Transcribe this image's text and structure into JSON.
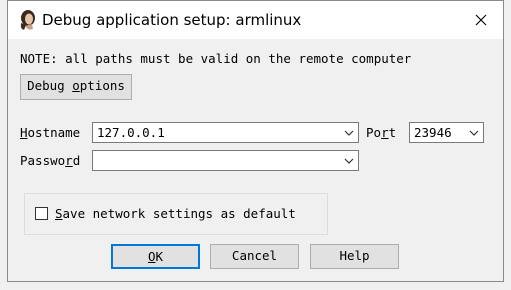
{
  "dialog": {
    "title": "Debug application setup: armlinux",
    "close_icon": "close-icon",
    "app_icon": "ida-icon"
  },
  "note": "NOTE: all paths must be valid on the remote computer",
  "debug_options_button": {
    "label": "Debug options",
    "mnemonic_prefix": "Debug ",
    "mnemonic_char": "o",
    "mnemonic_suffix": "ptions"
  },
  "hostname": {
    "label": "Hostname",
    "mnemonic_char": "H",
    "label_rest": "ostname",
    "value": "127.0.0.1"
  },
  "port": {
    "label": "Port",
    "label_prefix": "Po",
    "mnemonic_char": "r",
    "label_suffix": "t",
    "value": "23946"
  },
  "password": {
    "label": "Password",
    "label_prefix": "Passwo",
    "mnemonic_char": "r",
    "label_suffix": "d",
    "value": ""
  },
  "save_settings": {
    "label": "Save network settings as default",
    "mnemonic_char": "S",
    "label_rest": "ave network settings as default",
    "checked": false
  },
  "buttons": {
    "ok": {
      "mnemonic_char": "O",
      "label_rest": "K",
      "label": "OK"
    },
    "cancel": {
      "label": "Cancel"
    },
    "help": {
      "label": "Help"
    }
  }
}
